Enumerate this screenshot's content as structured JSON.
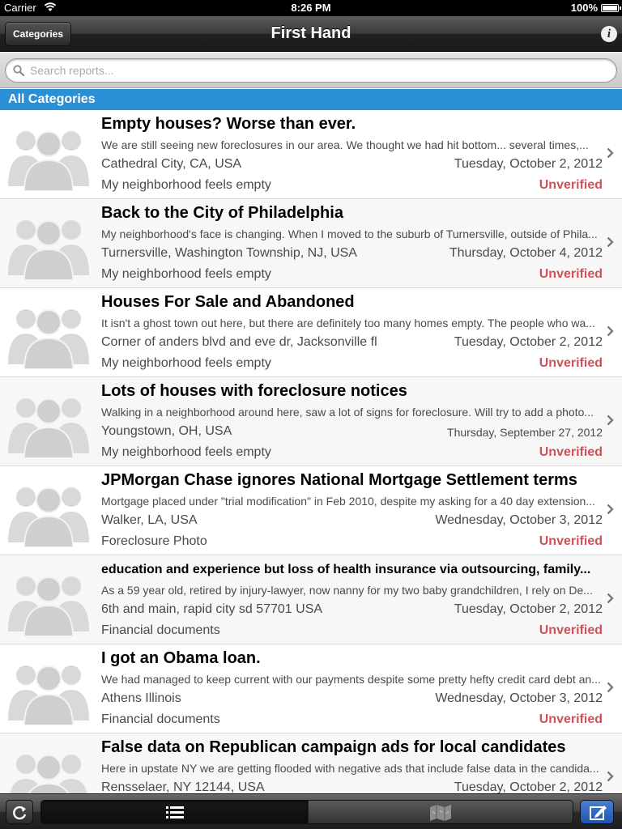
{
  "status_bar": {
    "carrier": "Carrier",
    "time": "8:26 PM",
    "battery": "100%"
  },
  "nav": {
    "title": "First Hand",
    "left_button": "Categories",
    "info_glyph": "i"
  },
  "search": {
    "placeholder": "Search reports..."
  },
  "section": {
    "label": "All Categories"
  },
  "colors": {
    "accent": "#2b8fd6",
    "status_unverified": "#c9545a",
    "compose": "#1d56b0"
  },
  "reports": [
    {
      "title": "Empty houses? Worse than ever.",
      "snippet": "We are still seeing new foreclosures in our area. We thought we had hit bottom... several times,...",
      "location": "Cathedral City, CA, USA",
      "date": "Tuesday, October 2, 2012",
      "category": "My neighborhood feels empty",
      "status": "Unverified"
    },
    {
      "title": "Back to the City of Philadelphia",
      "snippet": "My neighborhood's face is changing. When I moved to the suburb of Turnersville, outside of Phila...",
      "location": "Turnersville, Washington Township, NJ, USA",
      "date": "Thursday, October 4, 2012",
      "category": "My neighborhood feels empty",
      "status": "Unverified"
    },
    {
      "title": "Houses For Sale and Abandoned",
      "snippet": "It isn't a ghost town out here, but there are definitely too many homes empty.  The people who wa...",
      "location": "Corner of anders blvd and eve dr, Jacksonville fl",
      "date": "Tuesday, October 2, 2012",
      "category": "My neighborhood feels empty",
      "status": "Unverified"
    },
    {
      "title": "Lots of houses with foreclosure notices",
      "snippet": "Walking in a neighborhood around here, saw a lot of signs for foreclosure. Will try to add a photo...",
      "location": "Youngstown, OH, USA",
      "date": "Thursday, September 27, 2012",
      "category": "My neighborhood feels empty",
      "status": "Unverified"
    },
    {
      "title": "JPMorgan Chase ignores National Mortgage Settlement terms",
      "snippet": "Mortgage placed under \"trial modification\" in Feb 2010, despite my asking for a 40 day extension...",
      "location": "Walker, LA, USA",
      "date": "Wednesday, October 3, 2012",
      "category": "Foreclosure Photo",
      "status": "Unverified"
    },
    {
      "title": "education and experience but loss of health insurance via outsourcing, family...",
      "snippet": "As a 59 year old, retired by injury-lawyer, now nanny for my two baby grandchildren, I rely on De...",
      "location": "6th and main, rapid city sd 57701 USA",
      "date": "Tuesday, October 2, 2012",
      "category": "Financial documents",
      "status": "Unverified"
    },
    {
      "title": "I got an Obama loan.",
      "snippet": "We had managed to keep current with our payments despite some pretty hefty credit card debt an...",
      "location": "Athens Illinois",
      "date": "Wednesday, October 3, 2012",
      "category": "Financial documents",
      "status": "Unverified"
    },
    {
      "title": "False data on Republican campaign ads for local candidates",
      "snippet": "Here in upstate NY we are getting flooded with negative ads that include false data in the candida...",
      "location": "Rensselaer, NY 12144, USA",
      "date": "Tuesday, October 2, 2012",
      "category": "",
      "status": ""
    }
  ],
  "toolbar": {
    "refresh_icon": "refresh-icon",
    "list_icon": "list-icon",
    "map_icon": "map-icon",
    "compose_icon": "compose-icon"
  }
}
